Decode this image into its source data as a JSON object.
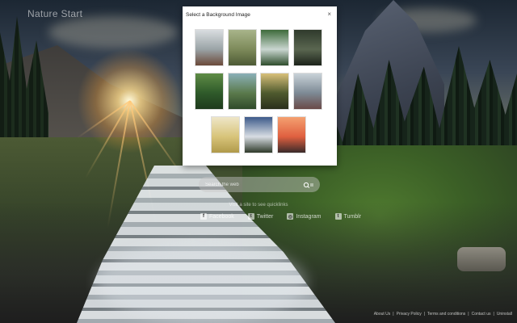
{
  "app": {
    "brand_text": "Nature Start"
  },
  "search": {
    "placeholder": "Search the web"
  },
  "quicklinks": {
    "title": "Visit a site to see quicklinks",
    "items": [
      {
        "label": "Facebook",
        "icon": "facebook-icon",
        "glyph": "f"
      },
      {
        "label": "Twitter",
        "icon": "twitter-icon",
        "glyph": "t"
      },
      {
        "label": "Instagram",
        "icon": "instagram-icon",
        "glyph": "◎"
      },
      {
        "label": "Tumblr",
        "icon": "tumblr-icon",
        "glyph": "t"
      }
    ]
  },
  "footer": {
    "links": [
      "About Us",
      "Privacy Policy",
      "Terms and conditions",
      "Contact us",
      "Uninstall"
    ],
    "separator": "|"
  },
  "modal": {
    "title": "Select a Background Image",
    "close_label": "×",
    "images": [
      {
        "name": "canoe-lake",
        "colors": [
          "#d9dde0",
          "#9aa3a6",
          "#6b4a3a"
        ]
      },
      {
        "name": "misty-forest",
        "colors": [
          "#a8b48a",
          "#7d8a5a",
          "#4d5a35"
        ]
      },
      {
        "name": "waterfall-green",
        "colors": [
          "#3d6a3a",
          "#c9d6d0",
          "#2e4d2c"
        ]
      },
      {
        "name": "dark-bridge",
        "colors": [
          "#2f3a2c",
          "#5a6650",
          "#1c231a"
        ]
      },
      {
        "name": "jungle-green",
        "colors": [
          "#5f8c46",
          "#2f5a2a",
          "#1e3a1c"
        ]
      },
      {
        "name": "mountain-valley",
        "colors": [
          "#8ab0b8",
          "#5b7a4c",
          "#2f4a2a"
        ]
      },
      {
        "name": "forest-path",
        "colors": [
          "#d8c07a",
          "#4f5a2e",
          "#2a2f1c"
        ]
      },
      {
        "name": "cliff-person",
        "colors": [
          "#c9d2d8",
          "#7d8a95",
          "#6a4a48"
        ]
      },
      {
        "name": "golden-grass",
        "colors": [
          "#eee6c8",
          "#d8c47a",
          "#b09a4a"
        ]
      },
      {
        "name": "yosemite-cliff",
        "colors": [
          "#3d5a8a",
          "#d8dde3",
          "#2f3a2a"
        ]
      },
      {
        "name": "sunset-water",
        "colors": [
          "#f4a070",
          "#e06040",
          "#3a2a2a"
        ]
      }
    ]
  },
  "colors": {
    "modal_bg": "#ffffff",
    "modal_text": "#222222"
  }
}
